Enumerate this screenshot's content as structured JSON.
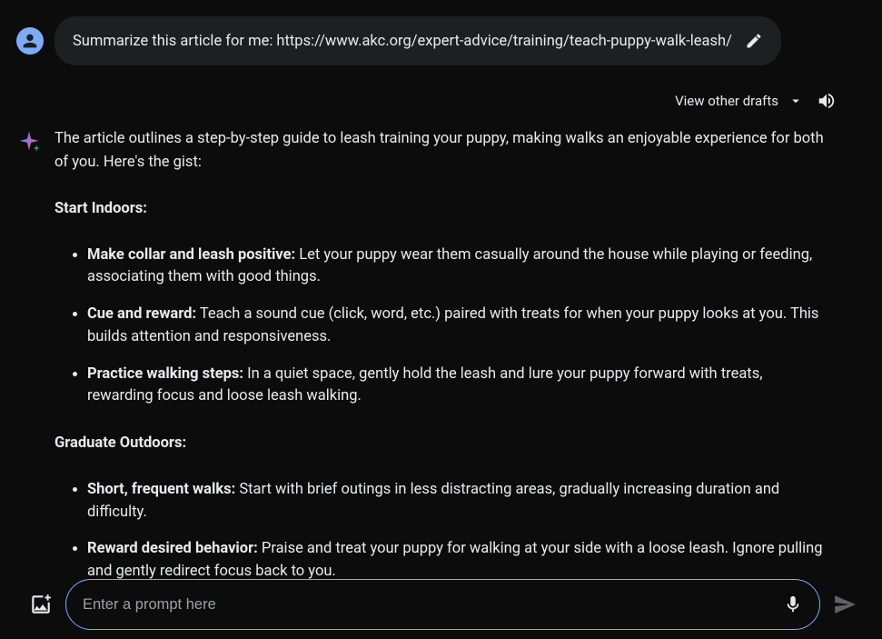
{
  "user": {
    "message": "Summarize this article for me: https://www.akc.org/expert-advice/training/teach-puppy-walk-leash/"
  },
  "header": {
    "view_drafts": "View other drafts"
  },
  "response": {
    "intro": "The article outlines a step-by-step guide to leash training your puppy, making walks an enjoyable experience for both of you. Here's the gist:",
    "section1_title": "Start Indoors:",
    "section1_items": [
      {
        "bold": "Make collar and leash positive:",
        "text": " Let your puppy wear them casually around the house while playing or feeding, associating them with good things."
      },
      {
        "bold": "Cue and reward:",
        "text": " Teach a sound cue (click, word, etc.) paired with treats for when your puppy looks at you. This builds attention and responsiveness."
      },
      {
        "bold": "Practice walking steps:",
        "text": " In a quiet space, gently hold the leash and lure your puppy forward with treats, rewarding focus and loose leash walking."
      }
    ],
    "section2_title": "Graduate Outdoors:",
    "section2_items": [
      {
        "bold": "Short, frequent walks:",
        "text": " Start with brief outings in less distracting areas, gradually increasing duration and difficulty."
      },
      {
        "bold": "Reward desired behavior:",
        "text": " Praise and treat your puppy for walking at your side with a loose leash. Ignore pulling and gently redirect focus back to you."
      }
    ]
  },
  "input": {
    "placeholder": "Enter a prompt here"
  }
}
